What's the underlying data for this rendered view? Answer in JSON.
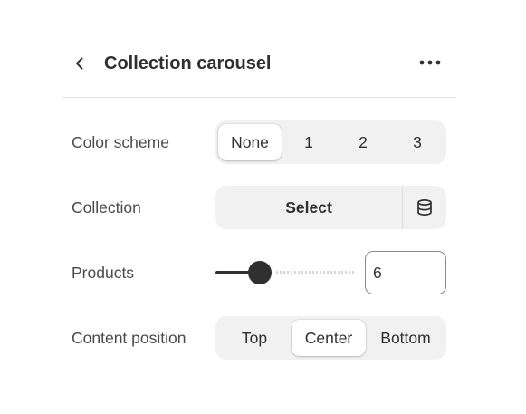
{
  "header": {
    "back_icon": "chevron-left-icon",
    "title": "Collection carousel",
    "more_icon": "ellipsis-icon"
  },
  "settings": {
    "color_scheme": {
      "label": "Color scheme",
      "options": [
        "None",
        "1",
        "2",
        "3"
      ],
      "selected": "None"
    },
    "collection": {
      "label": "Collection",
      "select_label": "Select",
      "source_icon": "database-icon"
    },
    "products": {
      "label": "Products",
      "value": "6",
      "slider_fraction": 0.32
    },
    "content_position": {
      "label": "Content position",
      "options": [
        "Top",
        "Center",
        "Bottom"
      ],
      "selected": "Center"
    }
  },
  "colors": {
    "text": "#303030",
    "label": "#4a4a4a",
    "control_bg": "#f1f1f1",
    "active_bg": "#ffffff",
    "slider": "#303030"
  }
}
